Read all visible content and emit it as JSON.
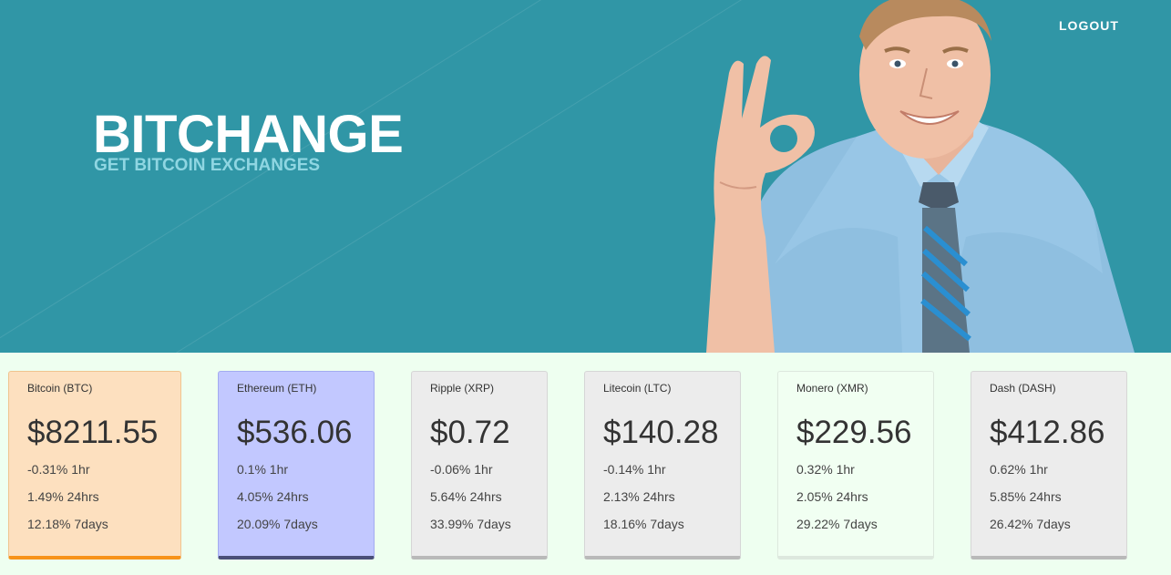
{
  "header": {
    "logout_label": "LOGOUT",
    "brand_title": "BITCHANGE",
    "brand_subtitle": "GET BITCOIN EXCHANGES",
    "background_color": "#3096a6"
  },
  "coins": [
    {
      "name": "Bitcoin (BTC)",
      "price": "$8211.55",
      "change_1hr": "-0.31% 1hr",
      "change_24hrs": "1.49% 24hrs",
      "change_7days": "12.18% 7days",
      "bg": "#fde0bf",
      "border": "#f0c48e",
      "accent": "#f7931a"
    },
    {
      "name": "Ethereum (ETH)",
      "price": "$536.06",
      "change_1hr": "0.1% 1hr",
      "change_24hrs": "4.05% 24hrs",
      "change_7days": "20.09% 7days",
      "bg": "#c2c8ff",
      "border": "#a3abf0",
      "accent": "#4a4f78"
    },
    {
      "name": "Ripple (XRP)",
      "price": "$0.72",
      "change_1hr": "-0.06% 1hr",
      "change_24hrs": "5.64% 24hrs",
      "change_7days": "33.99% 7days",
      "bg": "#ececec",
      "border": "#d6d6d6",
      "accent": "#b9b9b9"
    },
    {
      "name": "Litecoin (LTC)",
      "price": "$140.28",
      "change_1hr": "-0.14% 1hr",
      "change_24hrs": "2.13% 24hrs",
      "change_7days": "18.16% 7days",
      "bg": "#ececec",
      "border": "#d6d6d6",
      "accent": "#b9b9b9"
    },
    {
      "name": "Monero (XMR)",
      "price": "$229.56",
      "change_1hr": "0.32% 1hr",
      "change_24hrs": "2.05% 24hrs",
      "change_7days": "29.22% 7days",
      "bg": "#f1fff2",
      "border": "#dde8de",
      "accent": "#dde8de"
    },
    {
      "name": "Dash (DASH)",
      "price": "$412.86",
      "change_1hr": "0.62% 1hr",
      "change_24hrs": "5.85% 24hrs",
      "change_7days": "26.42% 7days",
      "bg": "#ececec",
      "border": "#d6d6d6",
      "accent": "#b9b9b9"
    }
  ]
}
